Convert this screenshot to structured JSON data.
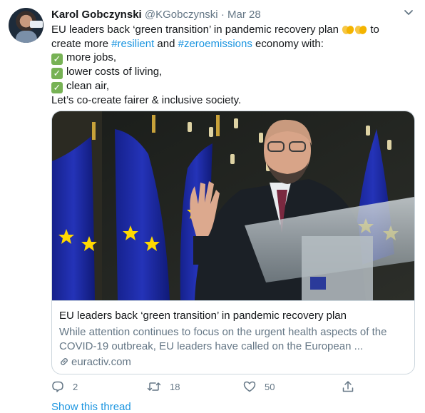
{
  "author": {
    "name": "Karol Gobczynski",
    "handle": "@KGobczynski",
    "separator": "·",
    "date": "Mar 28"
  },
  "tweet": {
    "line1_text": "EU leaders back ‘green transition’ in pandemic recovery plan",
    "line1_after": "to",
    "line2_before": "create more",
    "hashtag1": "#resilient",
    "line2_mid": "and",
    "hashtag2": "#zeroemissions",
    "line2_after": "economy with:",
    "items": [
      "more jobs,",
      "lower costs of living,",
      "clean air,"
    ],
    "closing": "Let’s co-create fairer & inclusive society."
  },
  "card": {
    "title": "EU leaders back ‘green transition’ in pandemic recovery plan",
    "desc_line1": "While attention continues to focus on the urgent health aspects of the",
    "desc_line2": "COVID-19 outbreak, EU leaders have called on the European ...",
    "domain": "euractiv.com"
  },
  "actions": {
    "replies": "2",
    "retweets": "18",
    "likes": "50"
  },
  "thread_link": "Show this thread",
  "colors": {
    "link": "#1b95e0",
    "muted": "#657786",
    "text": "#14171a",
    "border": "#ccd6dd",
    "check": "#77b255"
  },
  "icons": [
    "caret-down-icon",
    "clap-icon",
    "check-icon",
    "link-icon",
    "reply-icon",
    "retweet-icon",
    "like-icon",
    "share-icon"
  ]
}
